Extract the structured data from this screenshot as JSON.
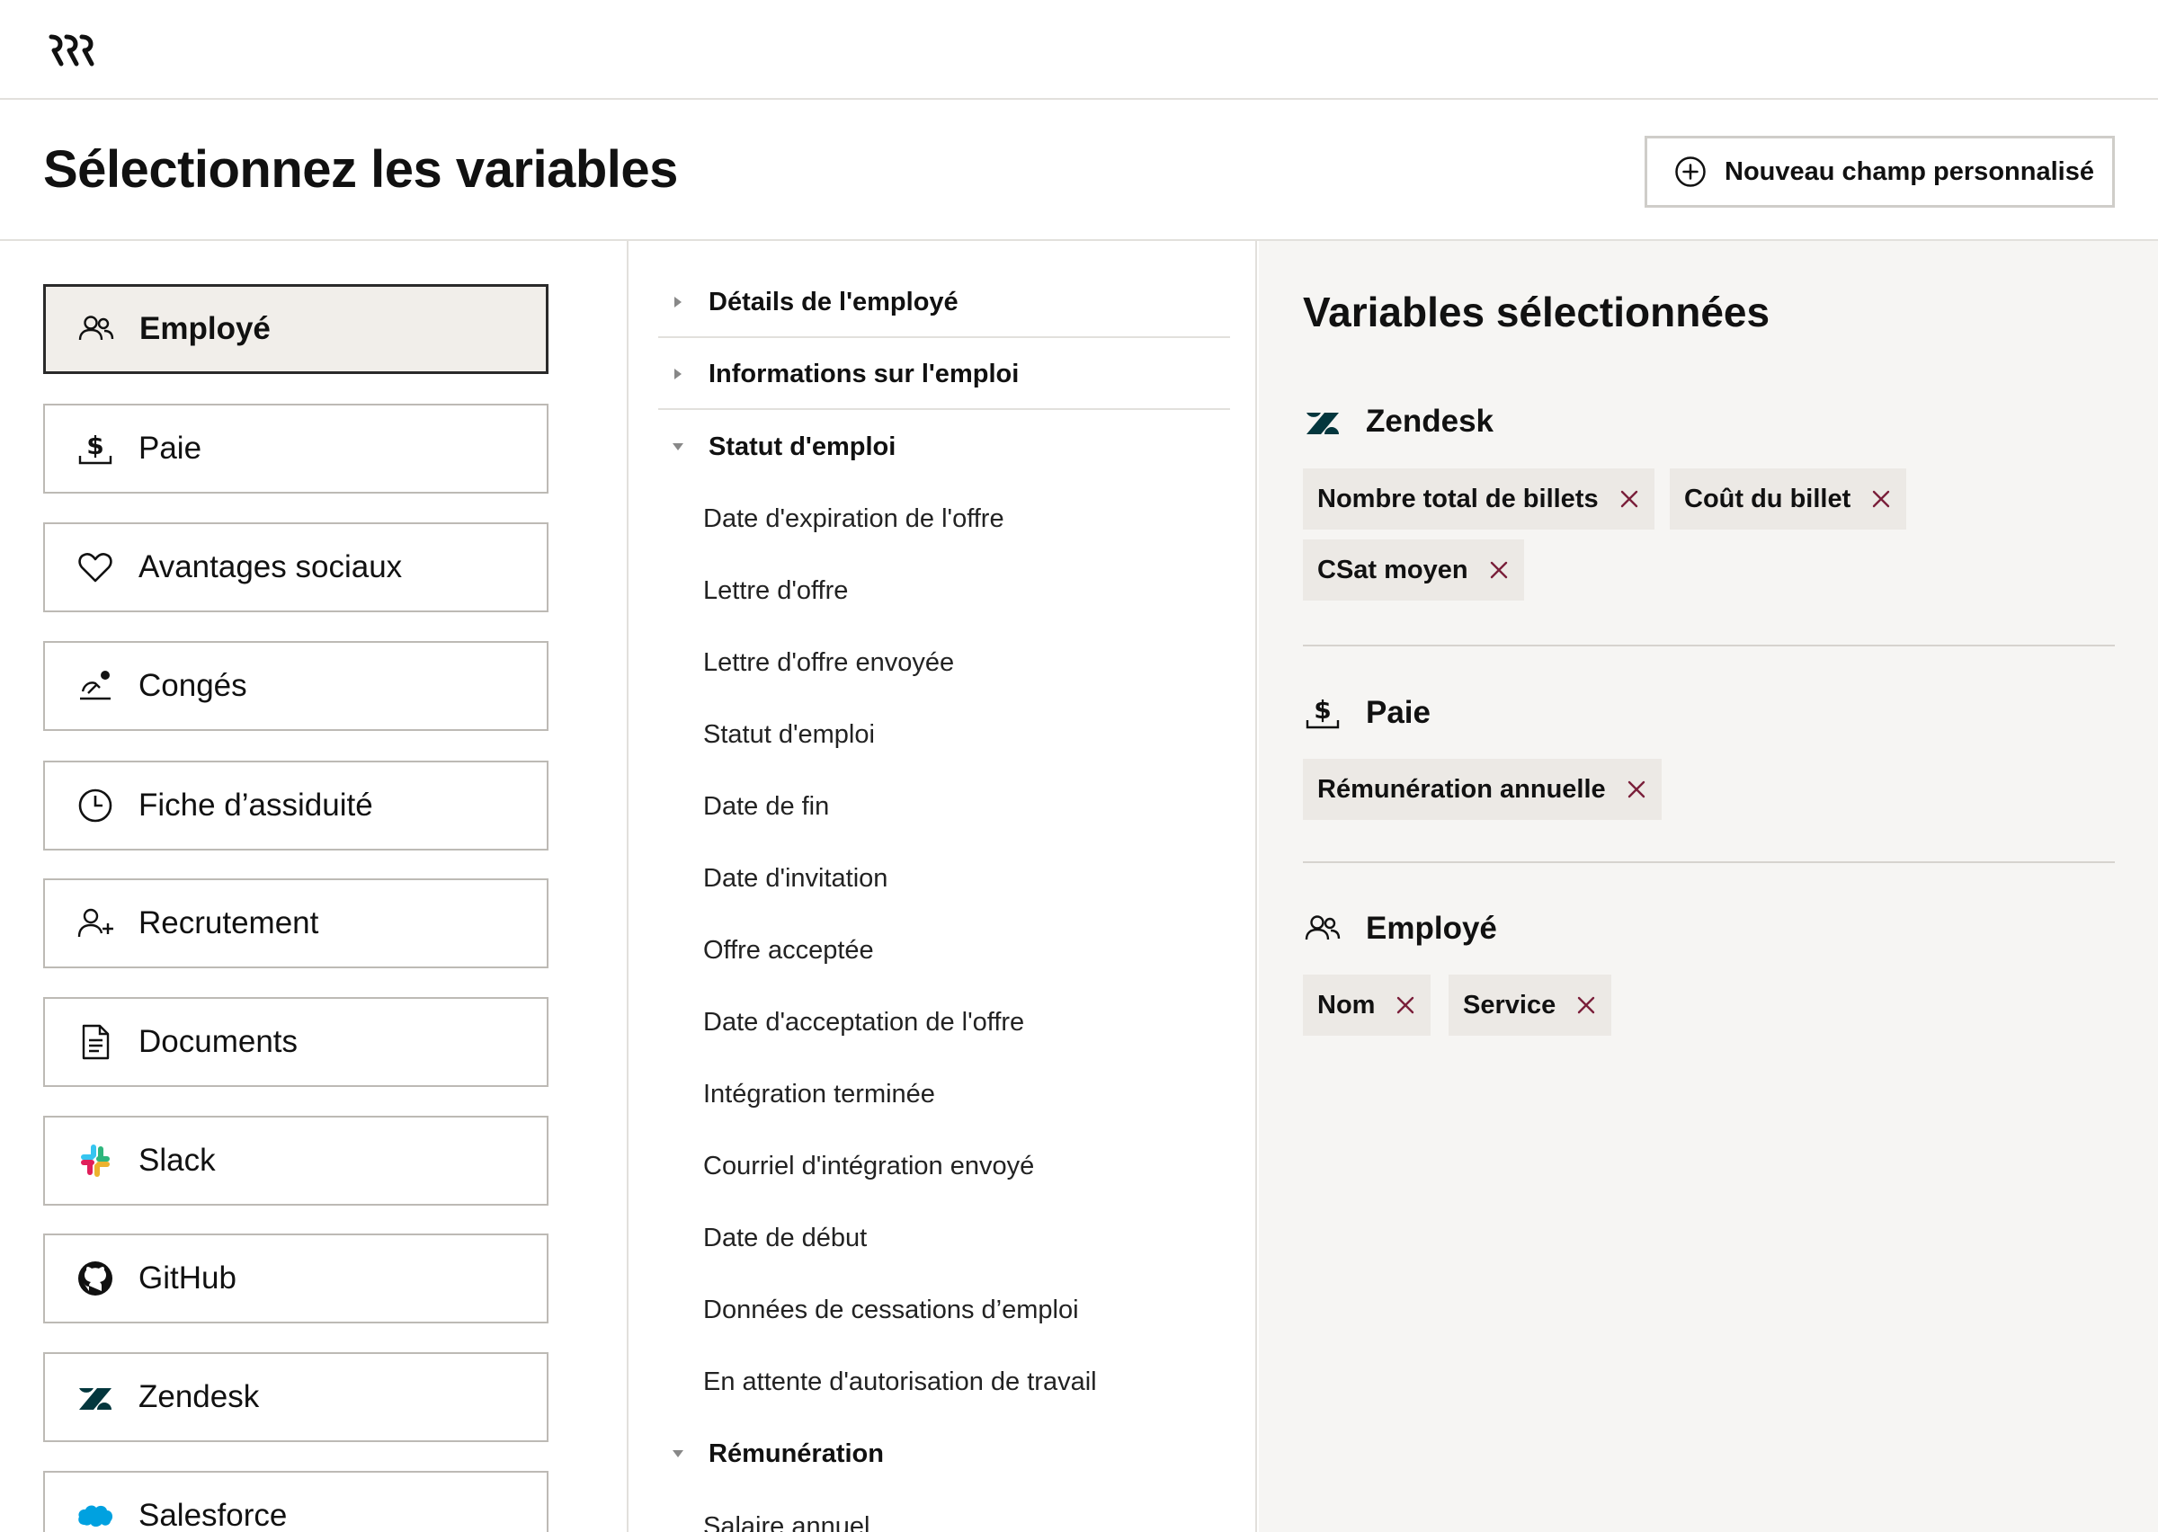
{
  "header": {
    "title": "Sélectionnez les variables",
    "new_field_button": "Nouveau champ personnalisé"
  },
  "categories": [
    {
      "label": "Employé",
      "icon": "people-icon",
      "active": true
    },
    {
      "label": "Paie",
      "icon": "payroll-dollar-icon"
    },
    {
      "label": "Avantages sociaux",
      "icon": "heart-icon"
    },
    {
      "label": "Congés",
      "icon": "time-off-icon"
    },
    {
      "label": "Fiche d’assiduité",
      "icon": "clock-icon"
    },
    {
      "label": "Recrutement",
      "icon": "user-plus-icon"
    },
    {
      "label": "Documents",
      "icon": "document-icon"
    },
    {
      "label": "Slack",
      "icon": "slack-icon"
    },
    {
      "label": "GitHub",
      "icon": "github-icon"
    },
    {
      "label": "Zendesk",
      "icon": "zendesk-icon"
    },
    {
      "label": "Salesforce",
      "icon": "salesforce-icon"
    }
  ],
  "sections": {
    "employee_details": "Détails de l'employé",
    "job_info": "Informations sur l'emploi",
    "employment_status": "Statut d'emploi",
    "compensation": "Rémunération"
  },
  "status_fields": [
    "Date d'expiration de l'offre",
    "Lettre d'offre",
    "Lettre d'offre envoyée",
    "Statut d'emploi",
    "Date de fin",
    "Date d'invitation",
    "Offre acceptée",
    "Date d'acceptation de l'offre",
    "Intégration terminée",
    "Courriel d'intégration envoyé",
    "Date de début",
    "Données de cessations d’emploi",
    "En attente d'autorisation de travail"
  ],
  "compensation_fields": [
    "Salaire annuel"
  ],
  "selected": {
    "title": "Variables sélectionnées",
    "groups": [
      {
        "label": "Zendesk",
        "chips": [
          "Nombre total de billets",
          "Coût du billet",
          "CSat moyen"
        ]
      },
      {
        "label": "Paie",
        "chips": [
          "Rémunération annuelle"
        ]
      },
      {
        "label": "Employé",
        "chips": [
          "Nom",
          "Service"
        ]
      }
    ]
  },
  "colors": {
    "active_bg": "#f1eeea",
    "panel_bg": "#f6f5f3",
    "chip_bg": "#ece9e5",
    "chip_x": "#7a1f3a",
    "zendesk": "#03363d"
  }
}
